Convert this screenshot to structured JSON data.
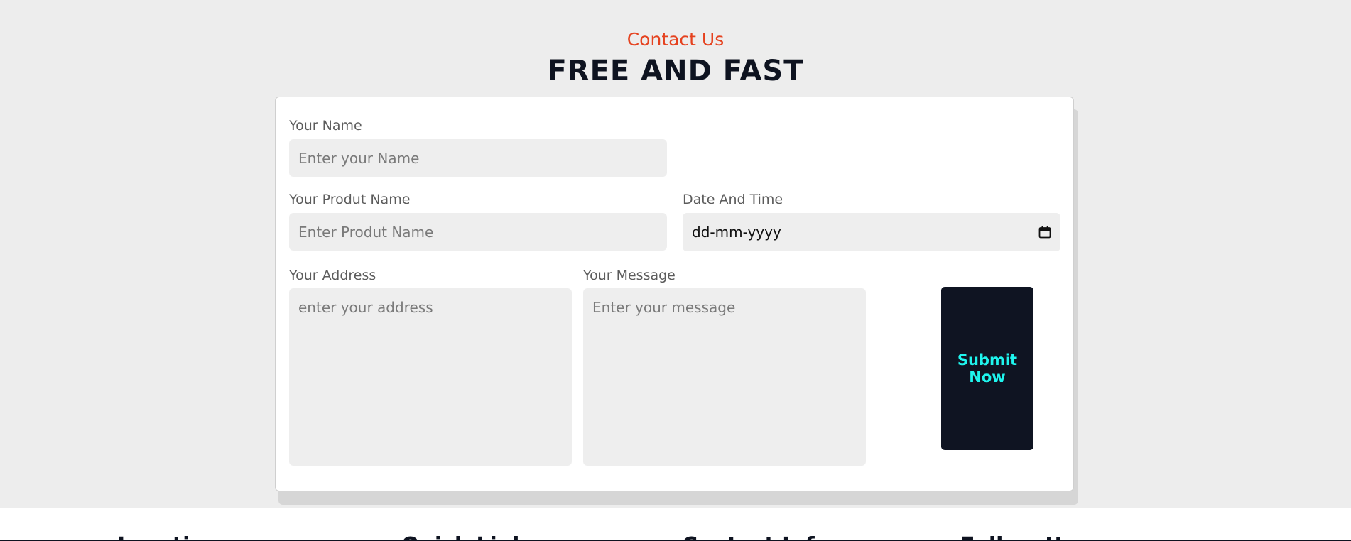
{
  "header": {
    "eyebrow": "Contact Us",
    "title": "FREE AND FAST"
  },
  "form": {
    "name": {
      "label": "Your Name",
      "placeholder": "Enter your Name"
    },
    "product": {
      "label": "Your Produt Name",
      "placeholder": "Enter Produt Name"
    },
    "datetime": {
      "label": "Date And Time",
      "value": "dd-mm-yyyy",
      "icon": "calendar-icon"
    },
    "address": {
      "label": "Your Address",
      "placeholder": "enter your address"
    },
    "message": {
      "label": "Your Message",
      "placeholder": "Enter your message"
    },
    "submit_label": "Submit Now"
  },
  "footer": {
    "headings": [
      "Location",
      "Quick Links",
      "Contact Info",
      "Follow Us"
    ]
  },
  "colors": {
    "accent": "#e5421f",
    "dark": "#0e1320",
    "button_text": "#1ff5ee",
    "field_bg": "#eeeeee",
    "page_bg": "#ededed"
  }
}
